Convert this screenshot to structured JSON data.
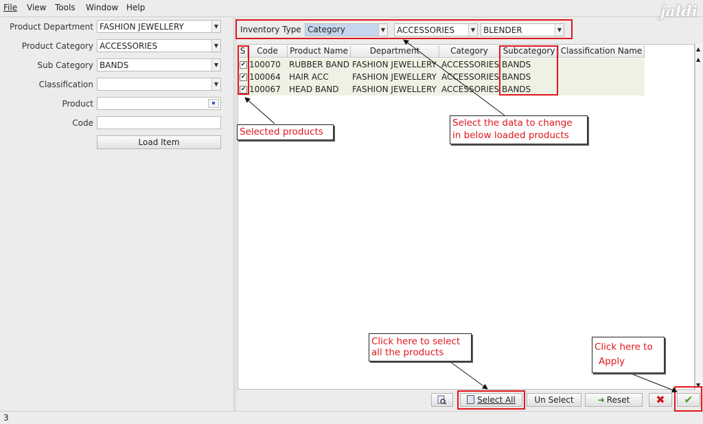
{
  "menu": [
    {
      "label": "File"
    },
    {
      "label": "View"
    },
    {
      "label": "Tools"
    },
    {
      "label": "Window"
    },
    {
      "label": "Help"
    }
  ],
  "logo": "jaldi",
  "form": {
    "department_label": "Product Department",
    "department_value": "FASHION JEWELLERY",
    "category_label": "Product Category",
    "category_value": "ACCESSORIES",
    "subcategory_label": "Sub Category",
    "subcategory_value": "BANDS",
    "classification_label": "Classification",
    "classification_value": "",
    "product_label": "Product",
    "product_value": "",
    "code_label": "Code",
    "code_value": "",
    "load_button": "Load Item"
  },
  "inventory": {
    "label": "Inventory Type",
    "type_value": "Category",
    "category_value": "ACCESSORIES",
    "subcategory_value": "BLENDER"
  },
  "table": {
    "headers": [
      "S",
      "Code",
      "Product Name",
      "Department",
      "Category",
      "Subcategory",
      "Classification Name"
    ],
    "rows": [
      {
        "checked": true,
        "code": "100070",
        "name": "RUBBER BAND",
        "department": "FASHION JEWELLERY",
        "category": "ACCESSORIES",
        "subcategory": "BANDS",
        "classification": ""
      },
      {
        "checked": true,
        "code": "100064",
        "name": "HAIR ACC",
        "department": "FASHION JEWELLERY",
        "category": "ACCESSORIES",
        "subcategory": "BANDS",
        "classification": ""
      },
      {
        "checked": true,
        "code": "100067",
        "name": "HEAD BAND",
        "department": "FASHION JEWELLERY",
        "category": "ACCESSORIES",
        "subcategory": "BANDS",
        "classification": ""
      }
    ]
  },
  "annotations": {
    "selected": "Selected products",
    "change_line1": "Select the data to change",
    "change_line2": "in below loaded products",
    "selectall_line1": "Click here to select",
    "selectall_line2": "all the products",
    "apply_line1": "Click here to",
    "apply_line2": "Apply"
  },
  "toolbar": {
    "select_all": "Select All",
    "unselect": "Un Select",
    "reset": "Reset"
  },
  "status": {
    "text": "3"
  },
  "colors": {
    "annotation_red": "#e0151b",
    "row_bg": "#eef2e4",
    "apply_green": "#5aa02c"
  }
}
